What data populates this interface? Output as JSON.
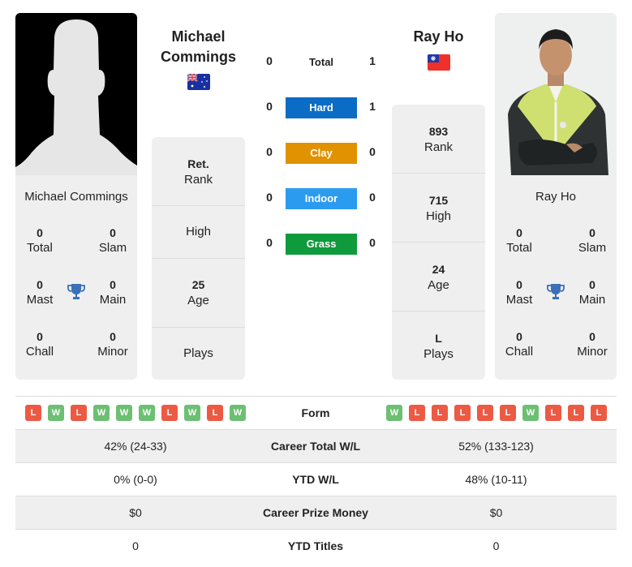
{
  "colors": {
    "hard": "#0a6cc4",
    "clay": "#e09200",
    "indoor": "#2b9bf0",
    "grass": "#0f9a3c",
    "win": "#6dbf73",
    "loss": "#ec5a44",
    "trophy": "#3b70b8"
  },
  "player1": {
    "name": "Michael Commings",
    "title_line1": "Michael",
    "title_line2": "Commings",
    "country_flag": "australia-flag",
    "photo": "silhouette-placeholder",
    "stats": {
      "total": {
        "value": "0",
        "label": "Total"
      },
      "slam": {
        "value": "0",
        "label": "Slam"
      },
      "mast": {
        "value": "0",
        "label": "Mast"
      },
      "main": {
        "value": "0",
        "label": "Main"
      },
      "chall": {
        "value": "0",
        "label": "Chall"
      },
      "minor": {
        "value": "0",
        "label": "Minor"
      }
    },
    "rank": {
      "value": "Ret.",
      "label": "Rank"
    },
    "high": {
      "value": "",
      "label": "High"
    },
    "age": {
      "value": "25",
      "label": "Age"
    },
    "plays": {
      "value": "",
      "label": "Plays"
    },
    "form": [
      "L",
      "W",
      "L",
      "W",
      "W",
      "W",
      "L",
      "W",
      "L",
      "W"
    ]
  },
  "player2": {
    "name": "Ray Ho",
    "title": "Ray Ho",
    "country_flag": "taiwan-flag",
    "photo": "player-photo",
    "stats": {
      "total": {
        "value": "0",
        "label": "Total"
      },
      "slam": {
        "value": "0",
        "label": "Slam"
      },
      "mast": {
        "value": "0",
        "label": "Mast"
      },
      "main": {
        "value": "0",
        "label": "Main"
      },
      "chall": {
        "value": "0",
        "label": "Chall"
      },
      "minor": {
        "value": "0",
        "label": "Minor"
      }
    },
    "rank": {
      "value": "893",
      "label": "Rank"
    },
    "high": {
      "value": "715",
      "label": "High"
    },
    "age": {
      "value": "24",
      "label": "Age"
    },
    "plays": {
      "value": "L",
      "label": "Plays"
    },
    "form": [
      "W",
      "L",
      "L",
      "L",
      "L",
      "L",
      "W",
      "L",
      "L",
      "L"
    ]
  },
  "h2h": {
    "total": {
      "label": "Total",
      "p1": "0",
      "p2": "1"
    },
    "surfaces": [
      {
        "key": "hard",
        "label": "Hard",
        "p1": "0",
        "p2": "1"
      },
      {
        "key": "clay",
        "label": "Clay",
        "p1": "0",
        "p2": "0"
      },
      {
        "key": "indoor",
        "label": "Indoor",
        "p1": "0",
        "p2": "0"
      },
      {
        "key": "grass",
        "label": "Grass",
        "p1": "0",
        "p2": "0"
      }
    ]
  },
  "table": {
    "form_label": "Form",
    "rows": [
      {
        "label": "Career Total W/L",
        "p1": "42% (24-33)",
        "p2": "52% (133-123)"
      },
      {
        "label": "YTD W/L",
        "p1": "0% (0-0)",
        "p2": "48% (10-11)"
      },
      {
        "label": "Career Prize Money",
        "p1": "$0",
        "p2": "$0"
      },
      {
        "label": "YTD Titles",
        "p1": "0",
        "p2": "0"
      }
    ]
  }
}
